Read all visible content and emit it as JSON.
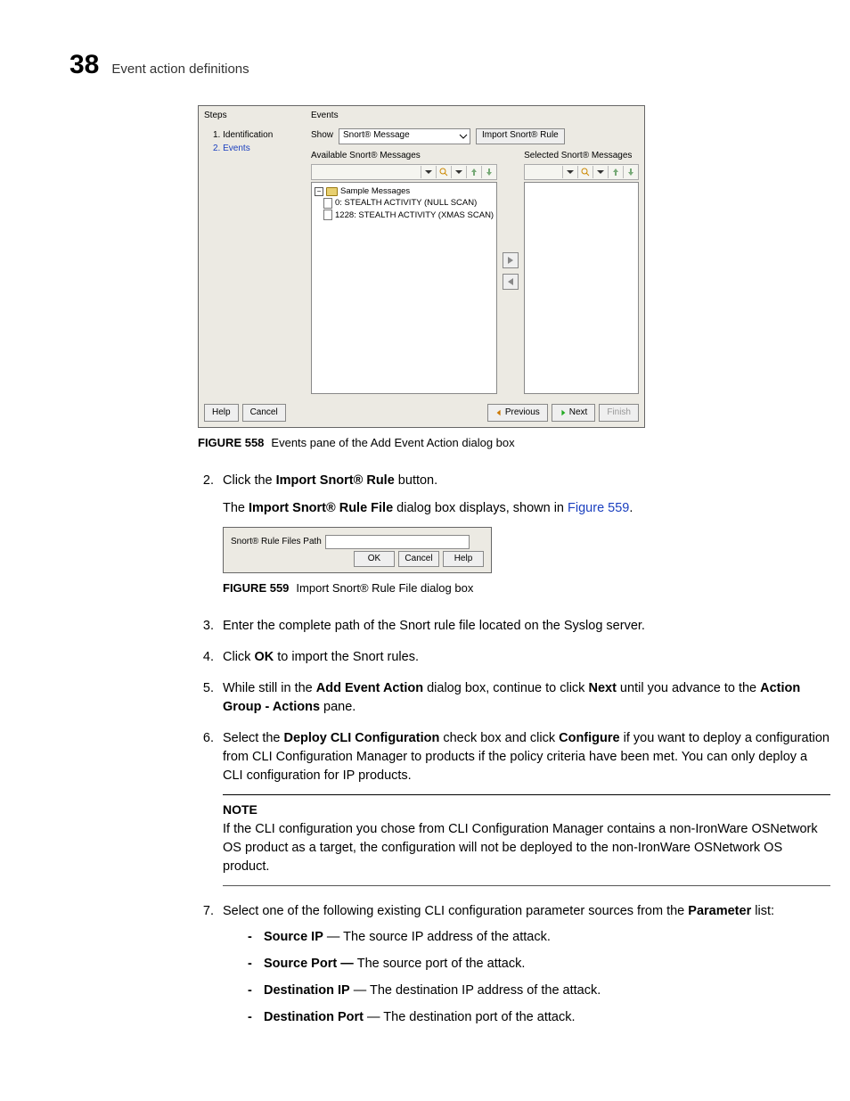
{
  "header": {
    "chapter": "38",
    "title": "Event action definitions"
  },
  "fig1": {
    "steps_label": "Steps",
    "steps": [
      "1. Identification",
      "2. Events"
    ],
    "events_label": "Events",
    "show_label": "Show",
    "show_value": "Snort® Message",
    "import_btn": "Import Snort® Rule",
    "avail_label": "Available Snort® Messages",
    "sel_label": "Selected Snort® Messages",
    "tree_root": "Sample Messages",
    "tree_items": [
      "0: STEALTH ACTIVITY (NULL SCAN)",
      "1228: STEALTH ACTIVITY (XMAS SCAN)"
    ],
    "help": "Help",
    "cancel": "Cancel",
    "prev": "Previous",
    "next": "Next",
    "finish": "Finish"
  },
  "cap1": {
    "label": "FIGURE 558",
    "text": "Events pane of the Add Event Action dialog box"
  },
  "step2": {
    "a": "Click the ",
    "b": "Import Snort® Rule",
    "c": " button.",
    "d": "The ",
    "e": "Import Snort® Rule File",
    "f": " dialog box displays, shown in ",
    "g": "Figure 559",
    "h": "."
  },
  "fig2": {
    "path_label": "Snort® Rule Files Path",
    "ok": "OK",
    "cancel": "Cancel",
    "help": "Help"
  },
  "cap2": {
    "label": "FIGURE 559",
    "text": "Import Snort® Rule File dialog box"
  },
  "step3": "Enter the complete path of the Snort rule file located on the Syslog server.",
  "step4": {
    "a": "Click ",
    "b": "OK",
    "c": " to import the Snort rules."
  },
  "step5": {
    "a": "While still in the ",
    "b": "Add Event Action",
    "c": " dialog box, continue to click ",
    "d": "Next",
    "e": " until you advance to the ",
    "f": "Action Group - Actions",
    "g": " pane."
  },
  "step6": {
    "a": "Select the ",
    "b": "Deploy CLI Configuration",
    "c": " check box and click ",
    "d": "Configure",
    "e": " if you want to deploy a configuration from CLI Configuration Manager to products if the policy criteria have been met. You can only deploy a CLI configuration for IP products."
  },
  "note": {
    "h": "NOTE",
    "body": "If the CLI configuration you chose from CLI Configuration Manager contains a non-IronWare OSNetwork OS product as a target, the configuration will not be deployed to the non-IronWare OSNetwork OS product."
  },
  "step7": {
    "a": "Select one of the following existing CLI configuration parameter sources from the ",
    "b": "Parameter",
    "c": " list:"
  },
  "params": [
    {
      "t": "Source IP",
      "d": " — The source IP address of the attack."
    },
    {
      "t": "Source Port — ",
      "d": "The source port of the attack."
    },
    {
      "t": "Destination IP",
      "d": " — The destination IP address of the attack."
    },
    {
      "t": "Destination Port",
      "d": " — The destination port of the attack."
    }
  ]
}
